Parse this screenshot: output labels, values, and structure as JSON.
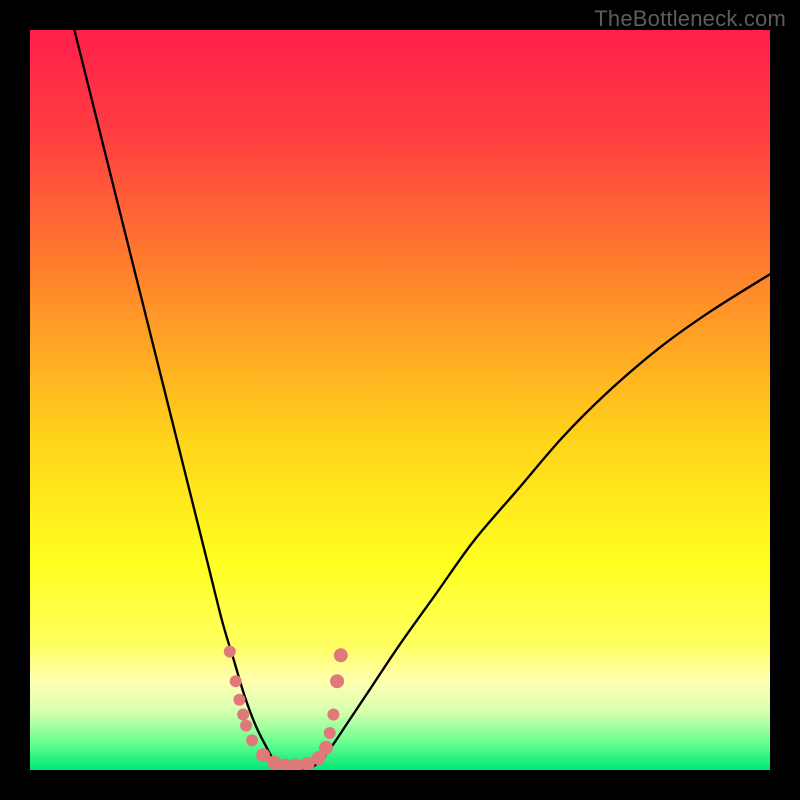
{
  "watermark": "TheBottleneck.com",
  "chart_data": {
    "type": "line",
    "title": "",
    "xlabel": "",
    "ylabel": "",
    "xlim": [
      0,
      100
    ],
    "ylim": [
      0,
      100
    ],
    "background_gradient": {
      "stops": [
        {
          "pos": 0.0,
          "color": "#ff1f4b"
        },
        {
          "pos": 0.15,
          "color": "#ff4040"
        },
        {
          "pos": 0.35,
          "color": "#ff8a2a"
        },
        {
          "pos": 0.55,
          "color": "#ffd21a"
        },
        {
          "pos": 0.72,
          "color": "#ffff20"
        },
        {
          "pos": 0.83,
          "color": "#ffff60"
        },
        {
          "pos": 0.88,
          "color": "#ffffb0"
        },
        {
          "pos": 0.92,
          "color": "#d8ffb0"
        },
        {
          "pos": 0.96,
          "color": "#70ff90"
        },
        {
          "pos": 1.0,
          "color": "#00e87a"
        }
      ]
    },
    "series": [
      {
        "name": "left-branch",
        "x": [
          6,
          8,
          10,
          12,
          14,
          16,
          18,
          20,
          22,
          24,
          26,
          27.5,
          29,
          30.5,
          32,
          33,
          34
        ],
        "y": [
          100,
          92,
          84,
          76,
          68,
          60,
          52,
          44,
          36,
          28,
          20,
          15,
          10,
          6,
          3,
          1.2,
          0.3
        ]
      },
      {
        "name": "right-branch",
        "x": [
          38,
          39.5,
          41,
          43,
          46,
          50,
          55,
          60,
          66,
          72,
          78,
          85,
          92,
          100
        ],
        "y": [
          0.3,
          1.5,
          3.5,
          6.5,
          11,
          17,
          24,
          31,
          38,
          45,
          51,
          57,
          62,
          67
        ]
      },
      {
        "name": "floor",
        "x": [
          34,
          35,
          36,
          37,
          38
        ],
        "y": [
          0.3,
          0.05,
          0.0,
          0.05,
          0.3
        ]
      }
    ],
    "highlight_points": {
      "name": "pink-markers",
      "color": "#e07a7a",
      "points": [
        {
          "x": 27.0,
          "y": 16.0,
          "r": 6
        },
        {
          "x": 27.8,
          "y": 12.0,
          "r": 6
        },
        {
          "x": 28.3,
          "y": 9.5,
          "r": 6
        },
        {
          "x": 28.8,
          "y": 7.5,
          "r": 6
        },
        {
          "x": 29.2,
          "y": 6.0,
          "r": 6
        },
        {
          "x": 30.0,
          "y": 4.0,
          "r": 6
        },
        {
          "x": 31.5,
          "y": 2.0,
          "r": 7
        },
        {
          "x": 33.0,
          "y": 1.0,
          "r": 7
        },
        {
          "x": 34.5,
          "y": 0.6,
          "r": 7
        },
        {
          "x": 36.0,
          "y": 0.6,
          "r": 7
        },
        {
          "x": 37.5,
          "y": 0.8,
          "r": 7
        },
        {
          "x": 39.0,
          "y": 1.6,
          "r": 7
        },
        {
          "x": 40.0,
          "y": 3.0,
          "r": 7
        },
        {
          "x": 40.5,
          "y": 5.0,
          "r": 6
        },
        {
          "x": 41.0,
          "y": 7.5,
          "r": 6
        },
        {
          "x": 41.5,
          "y": 12.0,
          "r": 7
        },
        {
          "x": 42.0,
          "y": 15.5,
          "r": 7
        }
      ]
    },
    "green_segments": {
      "color": "#2fb85a",
      "lines": [
        {
          "x1": 31.5,
          "y1": 2.2,
          "x2": 32.5,
          "y2": 1.3
        },
        {
          "x1": 39.5,
          "y1": 1.6,
          "x2": 40.2,
          "y2": 3.0
        }
      ]
    }
  }
}
